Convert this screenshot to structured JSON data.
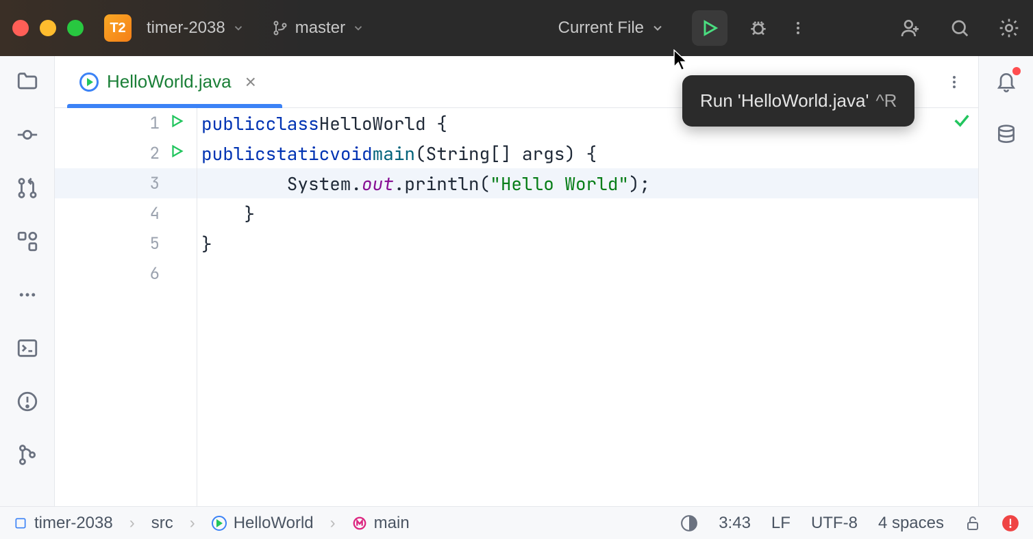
{
  "titlebar": {
    "project_badge": "T2",
    "project_name": "timer-2038",
    "branch": "master",
    "run_config": "Current File"
  },
  "tab": {
    "filename": "HelloWorld.java"
  },
  "tooltip": {
    "text": "Run 'HelloWorld.java'",
    "shortcut": "^R"
  },
  "code": {
    "lines": [
      {
        "n": 1,
        "gutter_run": true
      },
      {
        "n": 2,
        "gutter_run": true
      },
      {
        "n": 3,
        "current": true
      },
      {
        "n": 4
      },
      {
        "n": 5
      },
      {
        "n": 6
      }
    ],
    "l1_kw1": "public",
    "l1_kw2": "class",
    "l1_name": "HelloWorld {",
    "l2_kw1": "public",
    "l2_kw2": "static",
    "l2_kw3": "void",
    "l2_fn": "main",
    "l2_params": "(String[] args) {",
    "l3_pre": "        System.",
    "l3_fld": "out",
    "l3_mid": ".println(",
    "l3_str": "\"Hello World\"",
    "l3_post": ");",
    "l4": "    }",
    "l5": "}"
  },
  "breadcrumb": {
    "b1": "timer-2038",
    "b2": "src",
    "b3": "HelloWorld",
    "b4": "main"
  },
  "statusbar": {
    "cursor": "3:43",
    "line_sep": "LF",
    "encoding": "UTF-8",
    "indent": "4 spaces"
  }
}
